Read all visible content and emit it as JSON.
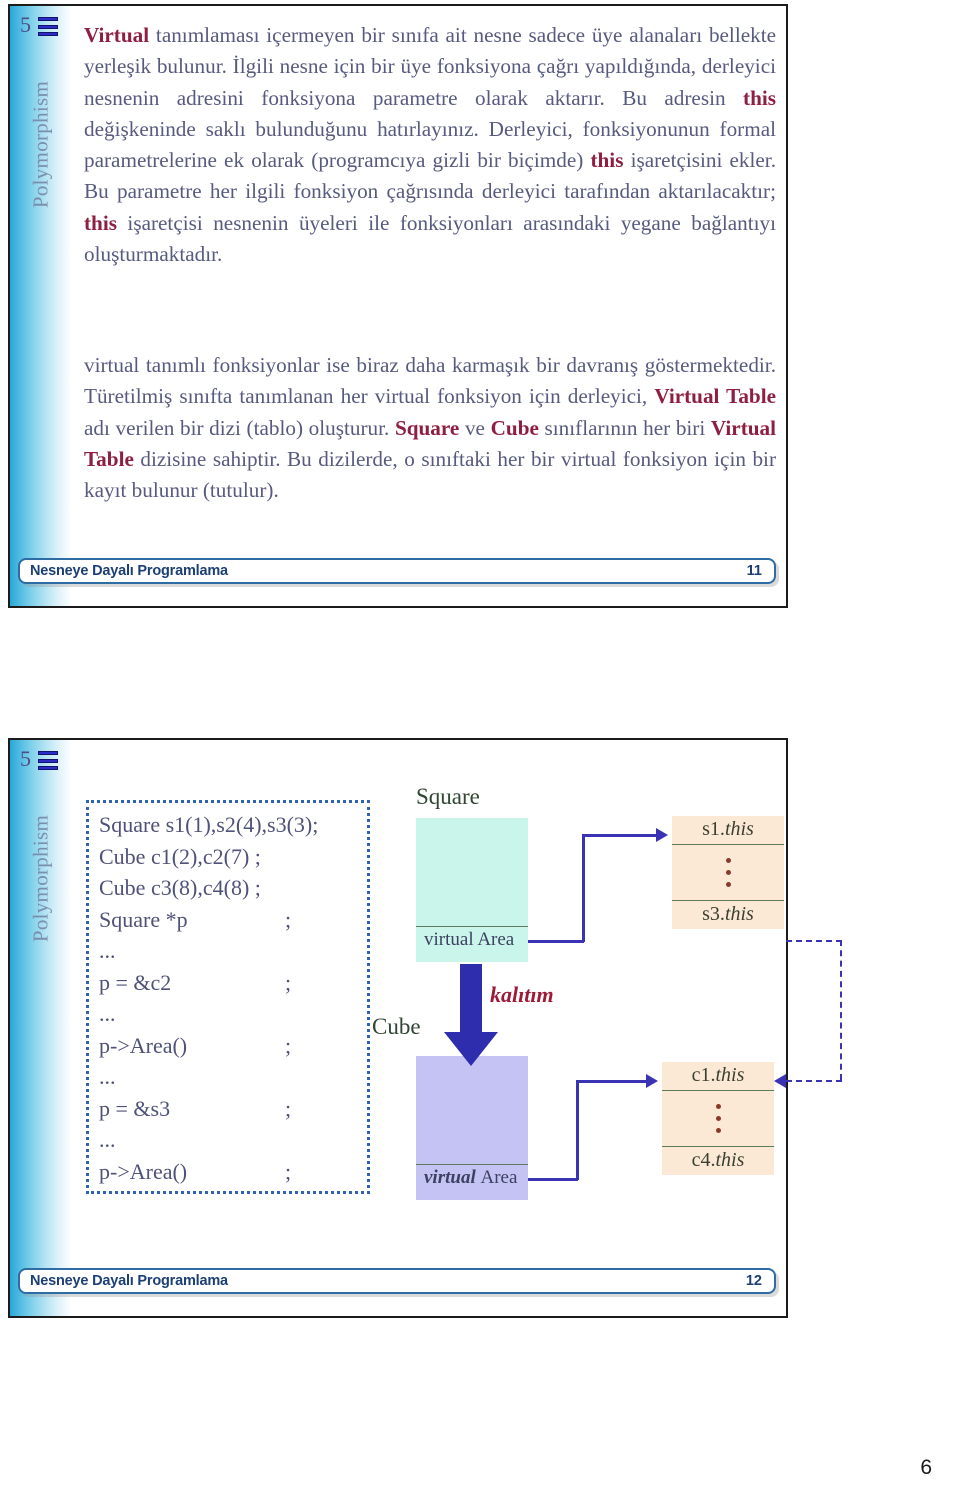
{
  "document": {
    "pdf_page_number": "6"
  },
  "slide1": {
    "sidebar": {
      "number": "5",
      "icon": "list-bars-icon",
      "vertical_title": "Polymorphism"
    },
    "paragraph_1_html": "<b>Virtual</b> tanımlaması içermeyen bir sınıfa ait nesne sadece üye alanaları bellekte yerleşik bulunur. İlgili nesne için bir üye fonksiyona çağrı yapıldığında, derleyici nesnenin adresini fonksiyona parametre olarak aktarır. Bu adresin <b>this</b> değişkeninde saklı bulunduğunu hatırlayınız. Derleyici, fonksiyonunun formal parametrelerine ek olarak (programcıya gizli bir biçimde) <b>this</b> işaretçisini ekler. Bu parametre her ilgili fonksiyon çağrısında derleyici tarafından aktarılacaktır; <b>this</b> işaretçisi nesnenin üyeleri ile fonksiyonları arasındaki yegane bağlantıyı oluşturmaktadır.",
    "paragraph_2_html": "virtual tanımlı fonksiyonlar ise biraz daha karmaşık bir davranış göstermektedir. Türetilmiş sınıfta tanımlanan her virtual fonksiyon için derleyici, <b>Virtual Table</b> adı verilen bir dizi (tablo) oluşturur. <b>Square</b> ve <b>Cube</b> sınıflarının her biri <b>Virtual Table</b> dizisine sahiptir. Bu dizilerde, o sınıftaki her bir virtual fonksiyon için bir kayıt bulunur (tutulur).",
    "footer": {
      "course": "Nesneye Dayalı Programlama",
      "page": "11"
    }
  },
  "slide2": {
    "sidebar": {
      "number": "5",
      "icon": "list-bars-icon",
      "vertical_title": "Polymorphism"
    },
    "code": {
      "lines": [
        {
          "text": "Square s1(1),s2(4),s3(3);",
          "semi": ""
        },
        {
          "text": "Cube c1(2),c2(7) ;",
          "semi": ""
        },
        {
          "text": "Cube c3(8),c4(8) ;",
          "semi": ""
        },
        {
          "text": "Square *p",
          "semi": ";"
        },
        {
          "text": "...",
          "semi": ""
        },
        {
          "text": "p = &c2",
          "semi": ";"
        },
        {
          "text": "...",
          "semi": ""
        },
        {
          "text": "p->Area()",
          "semi": ";"
        },
        {
          "text": "...",
          "semi": ""
        },
        {
          "text": "p = &s3",
          "semi": ";"
        },
        {
          "text": "...",
          "semi": ""
        },
        {
          "text": "p->Area()",
          "semi": ";"
        }
      ]
    },
    "diagram": {
      "square_label": "Square",
      "cube_label": "Cube",
      "square_vtable_entry_prefix": "virtual ",
      "square_vtable_entry_name": "Area",
      "cube_vtable_entry_prefix": "virtual ",
      "cube_vtable_entry_name": "Area",
      "inheritance_label": "kalıtım",
      "square_objects": {
        "first_prefix": "s1.",
        "first_italic": "this",
        "last_prefix": "s3.",
        "last_italic": "this"
      },
      "cube_objects": {
        "first_prefix": "c1.",
        "first_italic": "this",
        "last_prefix": "c4.",
        "last_italic": "this"
      },
      "colors": {
        "square_box": "#c9f5ea",
        "cube_box": "#c4c3f4",
        "object_box": "#fbe9d6",
        "arrow": "#3a34b5",
        "inheritance_arrow": "#2d2dad",
        "inheritance_text": "#9e1b38",
        "divider": "#5d7a5c"
      }
    },
    "footer": {
      "course": "Nesneye Dayalı Programlama",
      "page": "12"
    }
  }
}
